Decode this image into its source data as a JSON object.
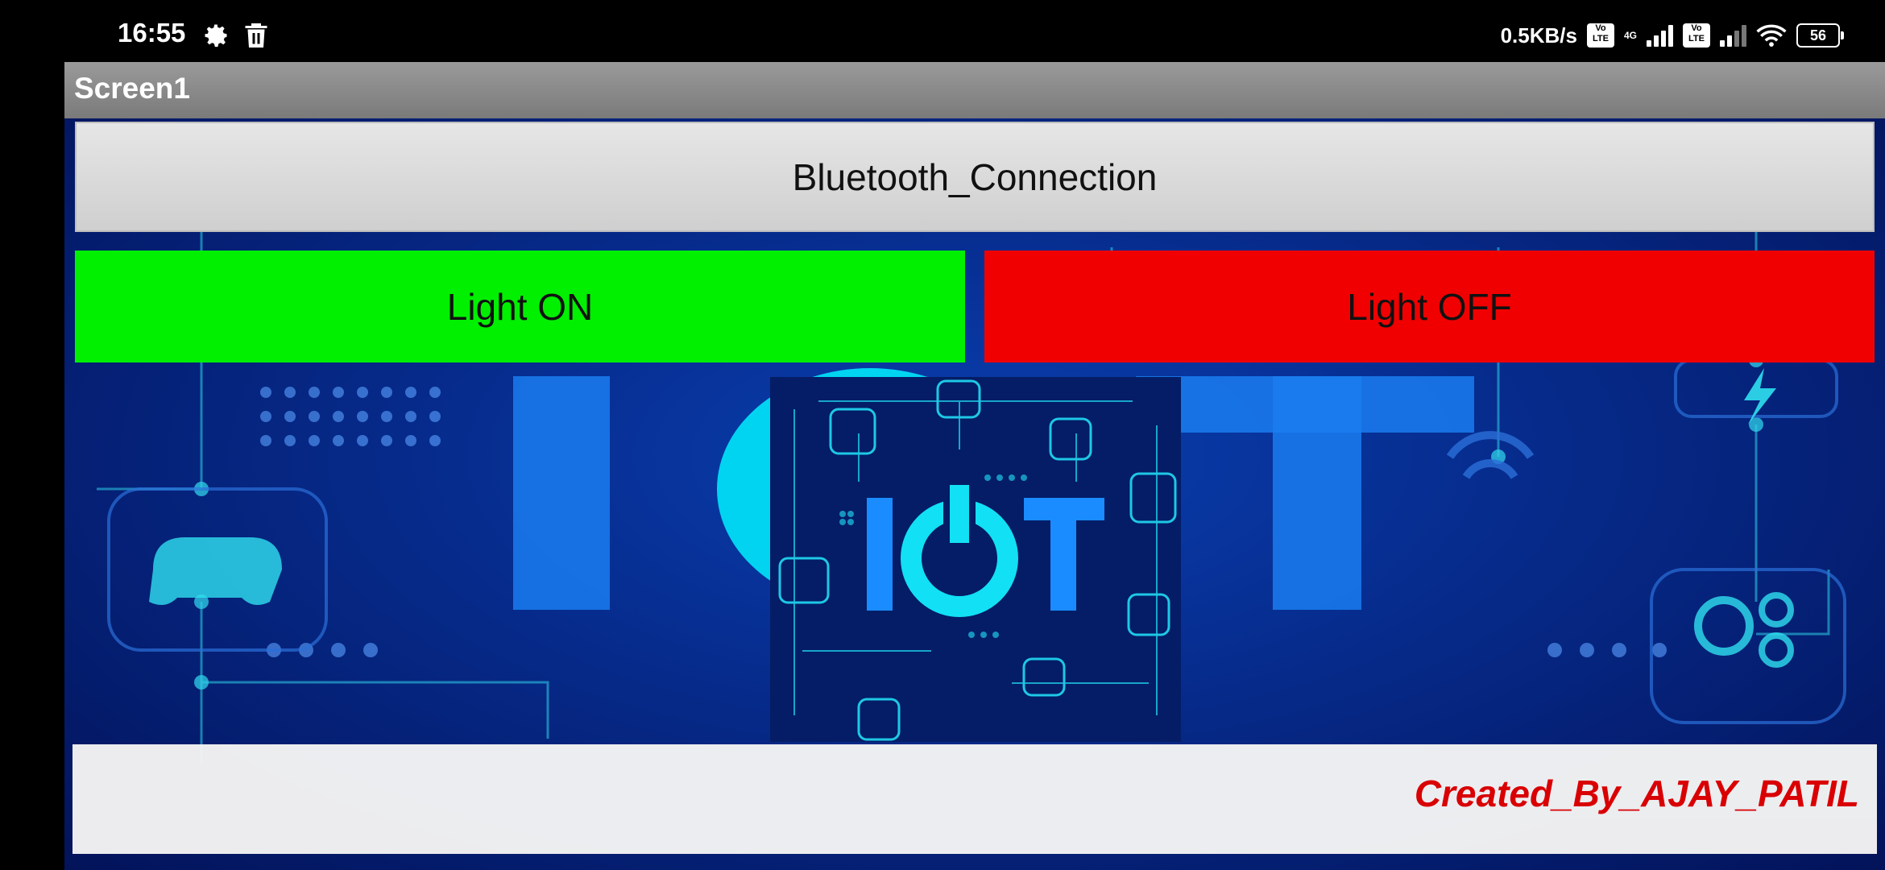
{
  "status_bar": {
    "time": "16:55",
    "net_speed": "0.5KB/s",
    "sim1_tag": "Vo LTE",
    "network_type": "4G",
    "sim2_tag": "Vo LTE",
    "battery": "56",
    "icons": [
      "gear-icon",
      "trash-icon",
      "signal-icon",
      "wifi-icon",
      "battery-icon"
    ]
  },
  "app": {
    "title": "Screen1",
    "buttons": {
      "bluetooth": "Bluetooth_Connection",
      "light_on": "Light ON",
      "light_off": "Light OFF"
    },
    "footer_text": "Created_By_AJAY_PATIL",
    "colors": {
      "light_on": "#00f000",
      "light_off": "#f00000",
      "footer_text": "#e00000",
      "background": "#062a8a",
      "accent_cyan": "#00e5ff"
    },
    "logo_text": "IOT"
  }
}
